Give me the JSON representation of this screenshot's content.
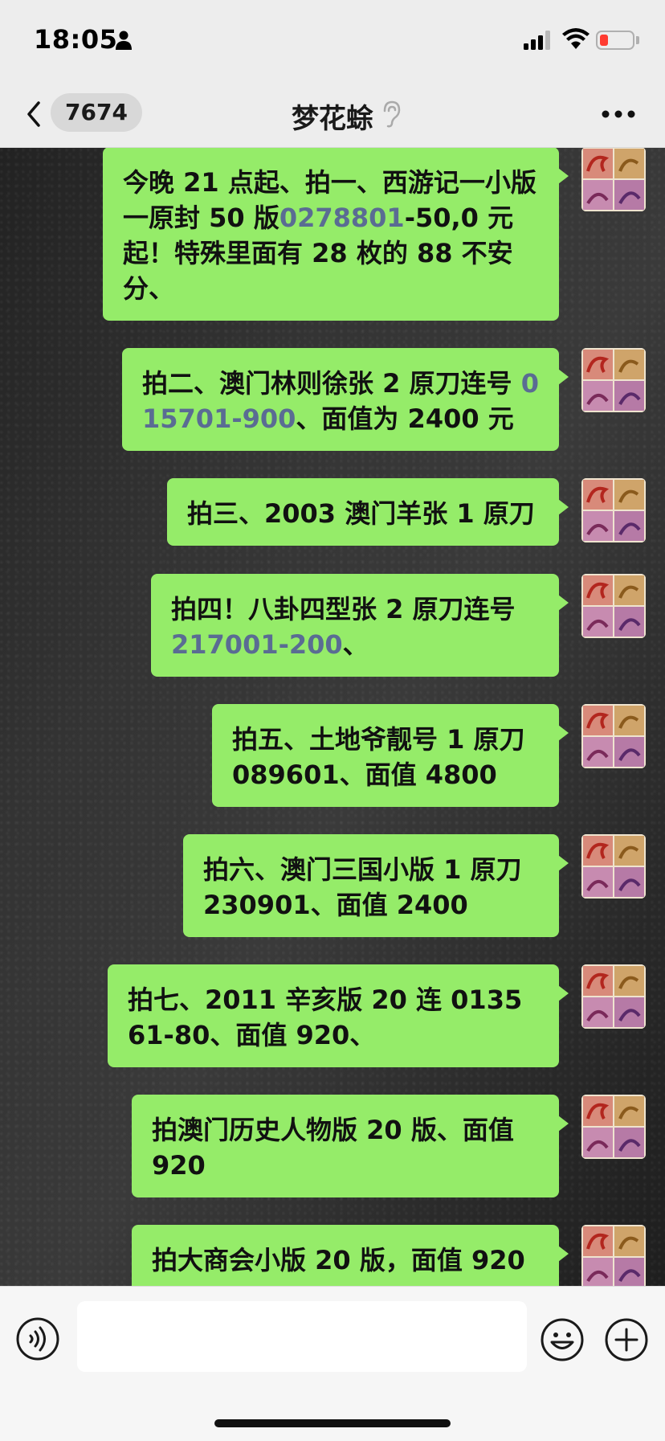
{
  "status": {
    "time": "18:05"
  },
  "nav": {
    "back_count": "7674",
    "title": "梦花蜍"
  },
  "messages": [
    {
      "parts": [
        {
          "t": "今晚 21 点起、拍一、西游记一小版一原封 50 版"
        },
        {
          "t": "0278801",
          "link": true
        },
        {
          "t": "-50,0 元起！特殊里面有 28 枚的 88 不安分、"
        }
      ]
    },
    {
      "parts": [
        {
          "t": "拍二、澳门林则徐张 2 原刀连号 "
        },
        {
          "t": "015701-900",
          "link": true
        },
        {
          "t": "、面值为 2400 元"
        }
      ]
    },
    {
      "parts": [
        {
          "t": "拍三、2003 澳门羊张 1 原刀"
        }
      ]
    },
    {
      "parts": [
        {
          "t": "拍四！八卦四型张 2 原刀连号 "
        },
        {
          "t": "217001-200",
          "link": true
        },
        {
          "t": "、"
        }
      ]
    },
    {
      "parts": [
        {
          "t": "拍五、土地爷靓号 1 原刀 089601、面值 4800"
        }
      ]
    },
    {
      "parts": [
        {
          "t": "拍六、澳门三国小版 1 原刀 230901、面值 2400"
        }
      ]
    },
    {
      "parts": [
        {
          "t": "拍七、2011 辛亥版 20 连 013561-80、面值 920、"
        }
      ]
    },
    {
      "parts": [
        {
          "t": "拍澳门历史人物版 20 版、面值 920"
        }
      ]
    },
    {
      "parts": [
        {
          "t": "拍大商会小版 20 版，面值 920"
        }
      ]
    }
  ],
  "input": {
    "value": ""
  },
  "colors": {
    "bubble": "#95ec69",
    "link": "#5a6c93",
    "bar": "#ededed"
  },
  "icons": [
    "back-chevron-icon",
    "person-icon",
    "signal-icon",
    "wifi-icon",
    "battery-icon",
    "ear-icon",
    "more-icon",
    "voice-icon",
    "emoji-icon",
    "plus-icon"
  ]
}
